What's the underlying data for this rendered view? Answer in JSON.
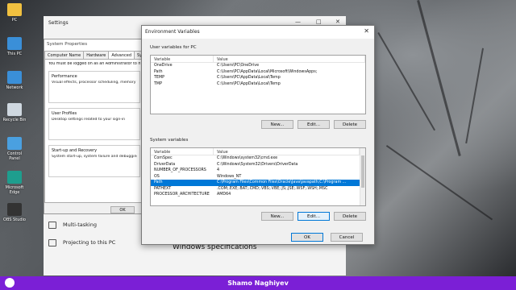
{
  "desktop": {
    "icons": [
      {
        "label": "PC",
        "color": "#f0c040"
      },
      {
        "label": "This PC",
        "color": "#3a8fd8"
      },
      {
        "label": "Network",
        "color": "#3a8fd8"
      },
      {
        "label": "Recycle Bin",
        "color": "#cfd8e0"
      },
      {
        "label": "Control Panel",
        "color": "#4aa0e0"
      },
      {
        "label": "Microsoft Edge",
        "color": "#1e9e8e"
      },
      {
        "label": "OBS Studio",
        "color": "#333333"
      }
    ]
  },
  "settings": {
    "title": "Settings",
    "left_items": [
      {
        "label": "Multi-tasking",
        "icon": "multitask-icon"
      },
      {
        "label": "Projecting to this PC",
        "icon": "project-icon"
      }
    ],
    "main_heading": "Windows specifications"
  },
  "system_properties": {
    "title": "System Properties",
    "tabs": [
      "Computer Name",
      "Hardware",
      "Advanced",
      "System"
    ],
    "active_tab": "Advanced",
    "note": "You must be logged on as an Administrator to make",
    "groups": [
      {
        "title": "Performance",
        "desc": "Visual effects, processor scheduling, memory usa"
      },
      {
        "title": "User Profiles",
        "desc": "Desktop settings related to your sign-in"
      },
      {
        "title": "Start-up and Recovery",
        "desc": "System start-up, system failure and debugging inf"
      }
    ],
    "ok_label": "OK"
  },
  "env_dialog": {
    "title": "Environment Variables",
    "user_section_label": "User variables for PC",
    "system_section_label": "System variables",
    "columns": {
      "name": "Variable",
      "value": "Value"
    },
    "user_vars": [
      {
        "name": "OneDrive",
        "value": "C:\\Users\\PC\\OneDrive"
      },
      {
        "name": "Path",
        "value": "C:\\Users\\PC\\AppData\\Local\\Microsoft\\WindowsApps;"
      },
      {
        "name": "TEMP",
        "value": "C:\\Users\\PC\\AppData\\Local\\Temp"
      },
      {
        "name": "TMP",
        "value": "C:\\Users\\PC\\AppData\\Local\\Temp"
      }
    ],
    "system_vars": [
      {
        "name": "ComSpec",
        "value": "C:\\Windows\\system32\\cmd.exe"
      },
      {
        "name": "DriverData",
        "value": "C:\\Windows\\System32\\Drivers\\DriverData"
      },
      {
        "name": "NUMBER_OF_PROCESSORS",
        "value": "4"
      },
      {
        "name": "OS",
        "value": "Windows_NT"
      },
      {
        "name": "Path",
        "value": "C:\\Program Files\\Common Files\\Oracle\\Java\\javapath;C:\\Program ...",
        "selected": true
      },
      {
        "name": "PATHEXT",
        "value": ".COM;.EXE;.BAT;.CMD;.VBS;.VBE;.JS;.JSE;.WSF;.WSH;.MSC"
      },
      {
        "name": "PROCESSOR_ARCHITECTURE",
        "value": "AMD64"
      }
    ],
    "user_buttons": {
      "new": "New...",
      "edit": "Edit...",
      "delete": "Delete"
    },
    "system_buttons": {
      "new": "New...",
      "edit": "Edit...",
      "delete": "Delete"
    },
    "ok_label": "OK",
    "cancel_label": "Cancel"
  },
  "banner": {
    "text": "Shamo Naghiyev",
    "color": "#7b1fd6"
  }
}
